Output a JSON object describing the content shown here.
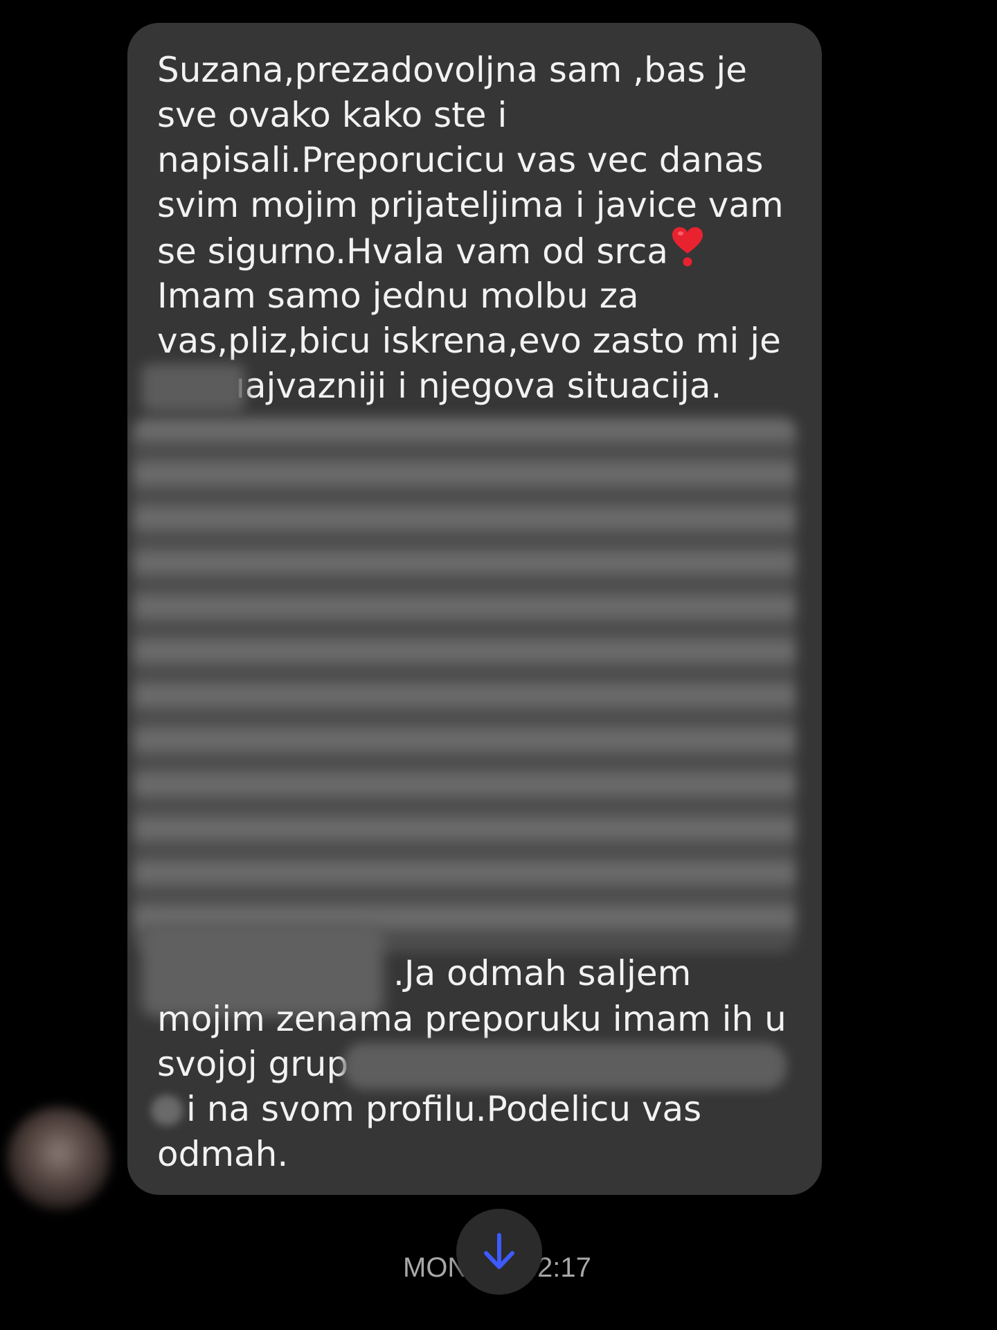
{
  "message": {
    "lines_top": [
      "Suzana,prezadovoljna sam ,bas je",
      "sve ovako kako ste i",
      "napisali.Preporucicu vas vec danas",
      "svim mojim prijateljima i javice vam",
      "se sigurno.Hvala vam od srca",
      "Imam samo jednu molbu za",
      "vas,pliz,bicu iskrena,evo zasto mi je",
      "ıajvazniji i njegova situacija."
    ],
    "lines_bottom": [
      ".Ja odmah saljem",
      "mojim zenama preporuku imam ih u",
      "svojoj grup",
      "i na svom profilu.Podelicu vas",
      "odmah."
    ],
    "heart_emoji": "heart-exclamation-icon"
  },
  "timestamp": {
    "left": "MON",
    "right": "2:17"
  },
  "scroll_button": {
    "icon": "arrow-down-icon"
  },
  "colors": {
    "background": "#000000",
    "bubble": "#363636",
    "text": "#f2f2f2",
    "timestamp": "#a9a9a9",
    "heart": "#e8232f",
    "scroll_arrow": "#3d5afe"
  }
}
